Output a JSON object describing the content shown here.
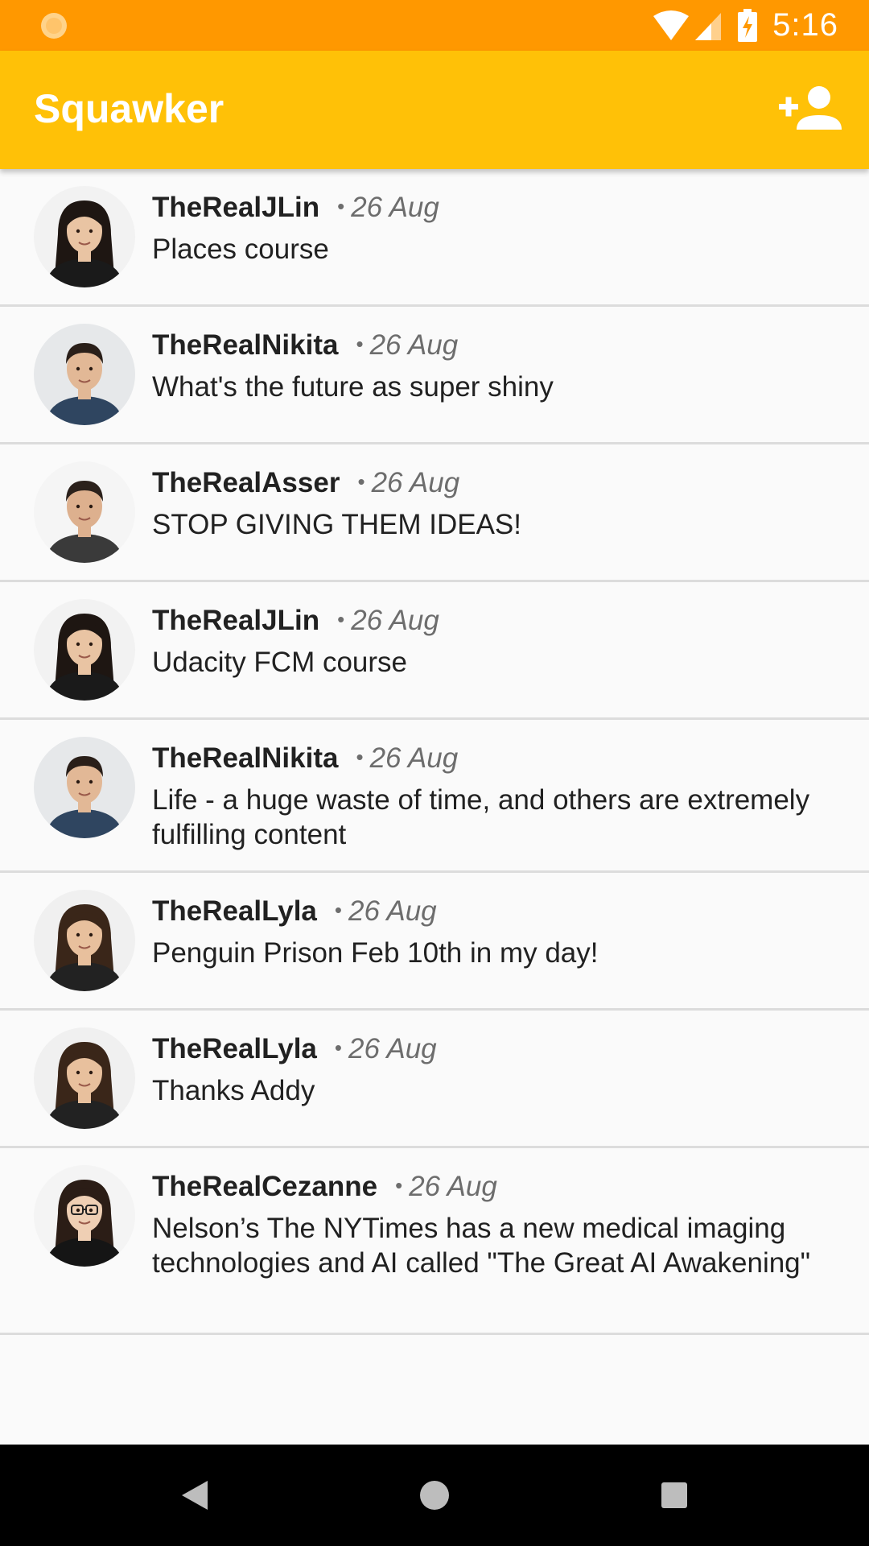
{
  "status_bar": {
    "time": "5:16",
    "color": "#ff9800",
    "icons": [
      "sun-icon",
      "wifi-icon",
      "signal-icon",
      "battery-charging-icon"
    ]
  },
  "app_bar": {
    "title": "Squawker",
    "color": "#ffc107",
    "action_icon": "add-person-icon"
  },
  "feed": {
    "items": [
      {
        "author": "TheRealJLin",
        "date": "26 Aug",
        "message": "Places course",
        "avatar": "woman-long-dark-hair"
      },
      {
        "author": "TheRealNikita",
        "date": "26 Aug",
        "message": "What's the future as super shiny",
        "avatar": "man-curly-hair"
      },
      {
        "author": "TheRealAsser",
        "date": "26 Aug",
        "message": "STOP GIVING THEM IDEAS!",
        "avatar": "man-short-hair-hoodie"
      },
      {
        "author": "TheRealJLin",
        "date": "26 Aug",
        "message": "Udacity FCM course",
        "avatar": "woman-long-dark-hair"
      },
      {
        "author": "TheRealNikita",
        "date": "26 Aug",
        "message": "Life - a huge waste of time, and others are extremely fulfilling content",
        "avatar": "man-curly-hair"
      },
      {
        "author": "TheRealLyla",
        "date": "26 Aug",
        "message": "Penguin Prison Feb 10th in my day!",
        "avatar": "woman-wavy-hair"
      },
      {
        "author": "TheRealLyla",
        "date": "26 Aug",
        "message": "Thanks Addy",
        "avatar": "woman-wavy-hair"
      },
      {
        "author": "TheRealCezanne",
        "date": "26 Aug",
        "message": "Nelson’s The NYTimes has a new medical imaging technologies and AI called \"The Great AI Awakening\"",
        "avatar": "woman-glasses"
      }
    ]
  },
  "nav_bar": {
    "buttons": [
      "back-icon",
      "home-icon",
      "recents-icon"
    ]
  }
}
